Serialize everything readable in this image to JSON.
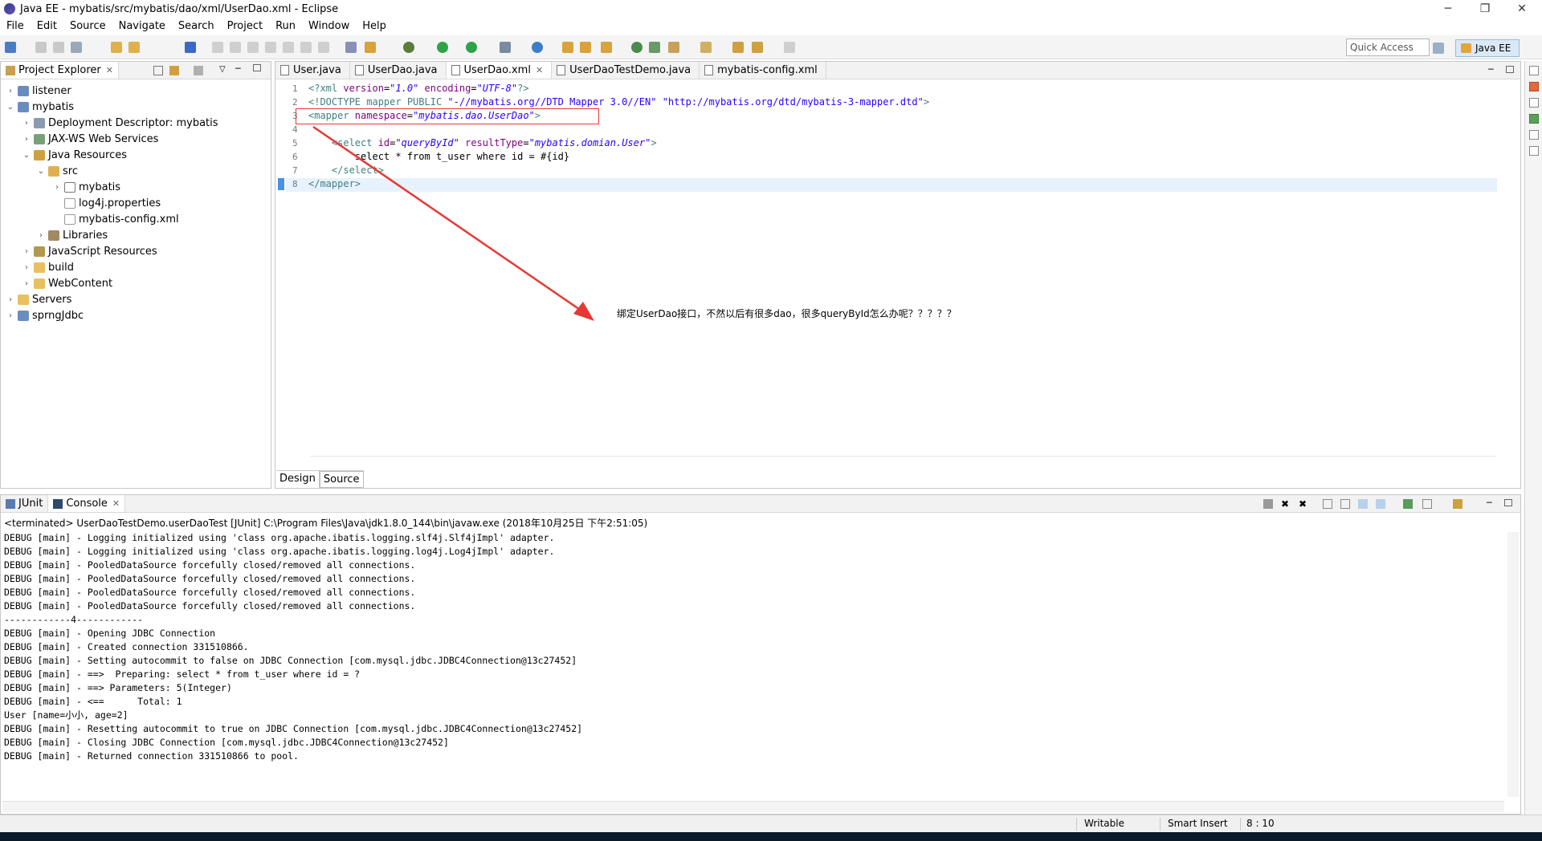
{
  "window": {
    "title": "Java EE - mybatis/src/mybatis/dao/xml/UserDao.xml - Eclipse",
    "minimize": "─",
    "maximize": "❐",
    "close": "✕"
  },
  "menu": [
    "File",
    "Edit",
    "Source",
    "Navigate",
    "Search",
    "Project",
    "Run",
    "Window",
    "Help"
  ],
  "toolbar": {
    "quick_access": "Quick Access",
    "perspective": "Java EE"
  },
  "project_explorer": {
    "tab_label": "Project Explorer",
    "tree": [
      {
        "label": "listener",
        "level": 0,
        "arrow": "›",
        "icon": "project-icon"
      },
      {
        "label": "mybatis",
        "level": 0,
        "arrow": "⌄",
        "icon": "project-icon"
      },
      {
        "label": "Deployment Descriptor: mybatis",
        "level": 1,
        "arrow": "›",
        "icon": "descriptor-icon"
      },
      {
        "label": "JAX-WS Web Services",
        "level": 1,
        "arrow": "›",
        "icon": "webservice-icon"
      },
      {
        "label": "Java Resources",
        "level": 1,
        "arrow": "⌄",
        "icon": "java-resources-icon"
      },
      {
        "label": "src",
        "level": 2,
        "arrow": "⌄",
        "icon": "source-folder-icon"
      },
      {
        "label": "mybatis",
        "level": 3,
        "arrow": "›",
        "icon": "package-icon"
      },
      {
        "label": "log4j.properties",
        "level": 3,
        "arrow": "",
        "icon": "properties-file-icon"
      },
      {
        "label": "mybatis-config.xml",
        "level": 3,
        "arrow": "",
        "icon": "xml-file-icon"
      },
      {
        "label": "Libraries",
        "level": 2,
        "arrow": "›",
        "icon": "libraries-icon"
      },
      {
        "label": "JavaScript Resources",
        "level": 1,
        "arrow": "›",
        "icon": "js-resources-icon"
      },
      {
        "label": "build",
        "level": 1,
        "arrow": "›",
        "icon": "folder-icon"
      },
      {
        "label": "WebContent",
        "level": 1,
        "arrow": "›",
        "icon": "folder-icon"
      },
      {
        "label": "Servers",
        "level": 0,
        "arrow": "›",
        "icon": "folder-icon"
      },
      {
        "label": "sprngJdbc",
        "level": 0,
        "arrow": "›",
        "icon": "project-icon"
      }
    ]
  },
  "editor": {
    "tabs": [
      {
        "label": "User.java",
        "active": false
      },
      {
        "label": "UserDao.java",
        "active": false
      },
      {
        "label": "UserDao.xml",
        "active": true
      },
      {
        "label": "UserDaoTestDemo.java",
        "active": false
      },
      {
        "label": "mybatis-config.xml",
        "active": false
      }
    ],
    "line_numbers": [
      "1",
      "2",
      "3",
      "4",
      "5",
      "6",
      "7",
      "8"
    ],
    "bottom_tabs": [
      "Design",
      "Source"
    ],
    "annotation": "绑定UserDao接口，不然以后有很多dao，很多queryById怎么办呢？？？？？"
  },
  "console": {
    "tabs": [
      "JUnit",
      "Console"
    ],
    "description": "<terminated> UserDaoTestDemo.userDaoTest [JUnit] C:\\Program Files\\Java\\jdk1.8.0_144\\bin\\javaw.exe (2018年10月25日 下午2:51:05)",
    "lines": [
      "DEBUG [main] - Logging initialized using 'class org.apache.ibatis.logging.slf4j.Slf4jImpl' adapter.",
      "DEBUG [main] - Logging initialized using 'class org.apache.ibatis.logging.log4j.Log4jImpl' adapter.",
      "DEBUG [main] - PooledDataSource forcefully closed/removed all connections.",
      "DEBUG [main] - PooledDataSource forcefully closed/removed all connections.",
      "DEBUG [main] - PooledDataSource forcefully closed/removed all connections.",
      "DEBUG [main] - PooledDataSource forcefully closed/removed all connections.",
      "------------4------------",
      "DEBUG [main] - Opening JDBC Connection",
      "DEBUG [main] - Created connection 331510866.",
      "DEBUG [main] - Setting autocommit to false on JDBC Connection [com.mysql.jdbc.JDBC4Connection@13c27452]",
      "DEBUG [main] - ==>  Preparing: select * from t_user where id = ?",
      "DEBUG [main] - ==> Parameters: 5(Integer)",
      "DEBUG [main] - <==      Total: 1",
      "User [name=小小, age=2]",
      "DEBUG [main] - Resetting autocommit to true on JDBC Connection [com.mysql.jdbc.JDBC4Connection@13c27452]",
      "DEBUG [main] - Closing JDBC Connection [com.mysql.jdbc.JDBC4Connection@13c27452]",
      "DEBUG [main] - Returned connection 331510866 to pool."
    ]
  },
  "statusbar": {
    "writable": "Writable",
    "insert_mode": "Smart Insert",
    "position": "8 : 10"
  },
  "colors": {
    "xml_tag": "#3f7f7f",
    "xml_attr": "#7f007f",
    "xml_value": "#2a00ff",
    "annotation_red": "#e53935",
    "current_line": "#e8f2fe"
  }
}
